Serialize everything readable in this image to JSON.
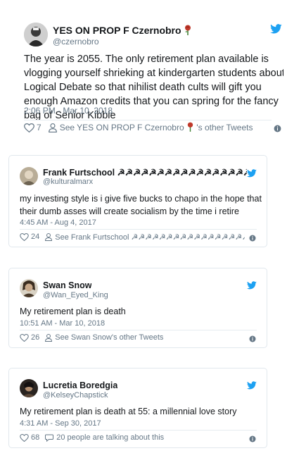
{
  "tweets": [
    {
      "name": "YES ON PROP F Czernobro",
      "handle": "@czernobro",
      "text": "The year is 2055. The only retirement plan available is vlogging yourself shrieking at kindergarten students about Logical Debate so that nihilist death cults will gift you enough Amazon credits that you can spring for the fancy bag of Senior Kibble",
      "time": "2:06 PM - Mar 10, 2018",
      "likes": "7",
      "see_text": "See YES ON PROP F Czernobro",
      "see_suffix": "'s other Tweets"
    },
    {
      "name": "Frank Furtschool ☭☭☭☭☭☭☭☭☭☭☭☭☭☭☭☭☭☭...",
      "handle": "@kulturalmarx",
      "text": "my investing style is i give five bucks to chapo in the hope that their dumb asses will create socialism by the time i retire",
      "time": "4:45 AM - Aug 4, 2017",
      "likes": "24",
      "see_text": "See Frank Furtschool ☭☭☭☭☭☭☭☭☭☭☭☭☭☭☭☭☭☭..."
    },
    {
      "name": "Swan Snow",
      "handle": "@Wan_Eyed_King",
      "text": "My retirement plan is death",
      "time": "10:51 AM - Mar 10, 2018",
      "likes": "26",
      "see_text": "See Swan Snow's other Tweets"
    },
    {
      "name": "Lucretia Boredgia",
      "handle": "@KelseyChapstick",
      "text": "My retirement plan is death at 55: a millennial love story",
      "time": "4:31 AM - Sep 30, 2017",
      "likes": "68",
      "see_text": "20 people are talking about this"
    }
  ],
  "colors": {
    "twitter_blue": "#1da1f2",
    "muted": "#657786",
    "rose": "#c0392b",
    "border": "#e1e8ed"
  },
  "icons": [
    "twitter-bird-icon",
    "heart-icon",
    "person-icon",
    "comment-icon",
    "info-icon",
    "rose-emoji"
  ]
}
